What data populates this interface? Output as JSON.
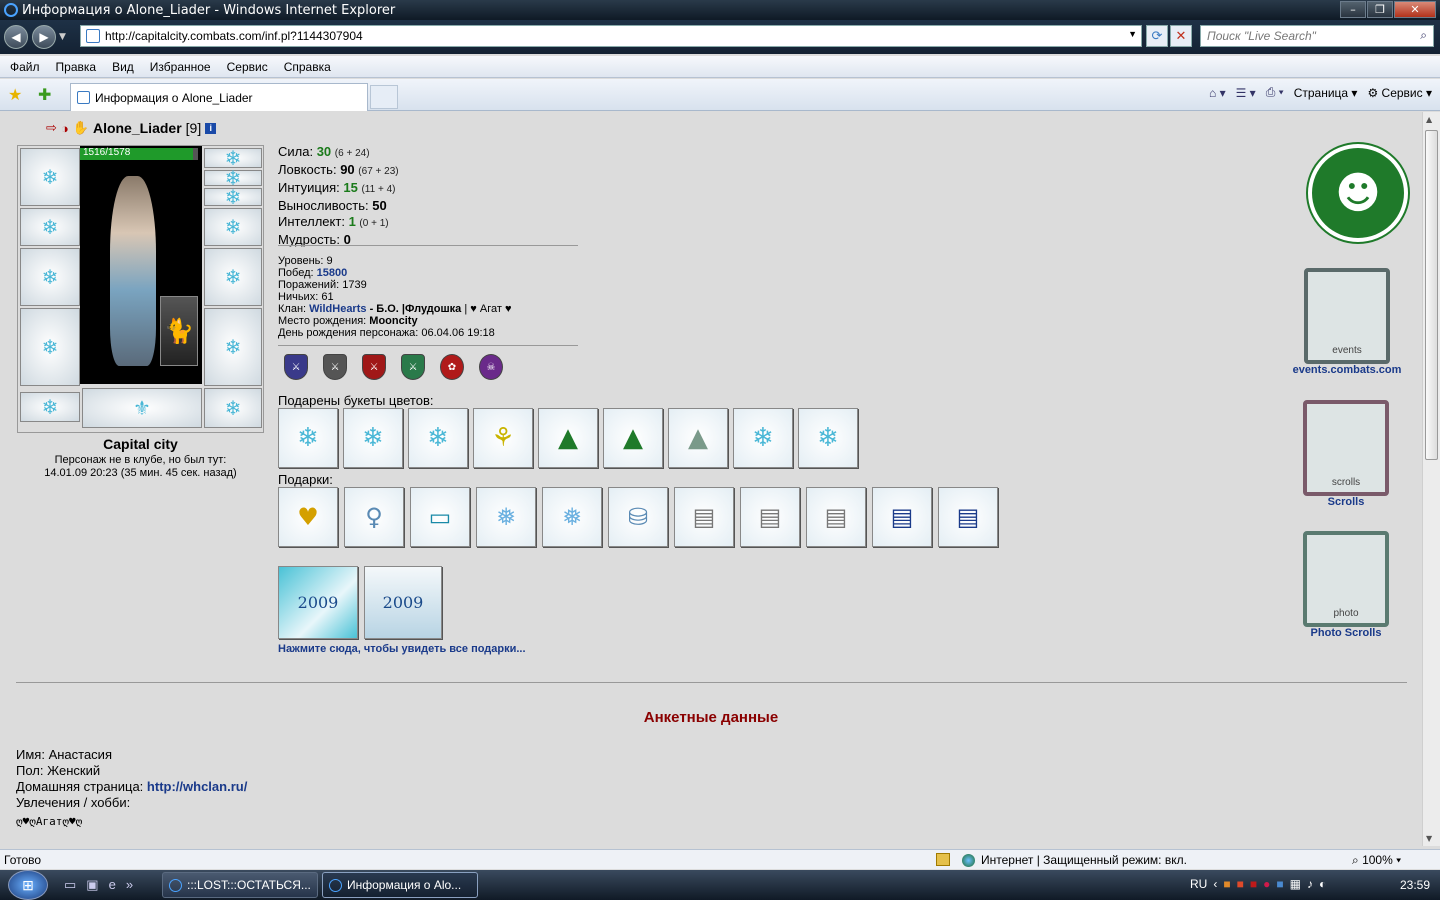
{
  "window": {
    "title": "Информация о Alone_Liader - Windows Internet Explorer",
    "address": "http://capitalcity.combats.com/inf.pl?1144307904",
    "search_placeholder": "Поиск \"Live Search\""
  },
  "menu": [
    "Файл",
    "Правка",
    "Вид",
    "Избранное",
    "Сервис",
    "Справка"
  ],
  "tab": {
    "label": "Информация о Alone_Liader"
  },
  "commandbar": {
    "page_label": "Страница",
    "tools_label": "Сервис"
  },
  "character": {
    "name": "Alone_Liader",
    "level": "[9]",
    "hp": "1516/1578",
    "hp_fraction": 0.96,
    "city": "Capital city",
    "status_line1": "Персонаж не в клубе, но был тут:",
    "status_line2": "14.01.09 20:23 (35 мин. 45 сек. назад)"
  },
  "stats": [
    {
      "label": "Сила:",
      "value": "30",
      "detail": "(6 + 24)",
      "green": true
    },
    {
      "label": "Ловкость:",
      "value": "90",
      "detail": "(67 + 23)",
      "green": false
    },
    {
      "label": "Интуиция:",
      "value": "15",
      "detail": "(11 + 4)",
      "green": true
    },
    {
      "label": "Выносливость:",
      "value": "50",
      "detail": "",
      "green": false
    },
    {
      "label": "Интеллект:",
      "value": "1",
      "detail": "(0 + 1)",
      "green": true
    },
    {
      "label": "Мудрость:",
      "value": "0",
      "detail": "",
      "green": false
    }
  ],
  "info": {
    "level_label": "Уровень:",
    "level_value": "9",
    "wins_label": "Побед:",
    "wins_value": "15800",
    "losses_label": "Поражений:",
    "losses_value": "1739",
    "draws_label": "Ничьих:",
    "draws_value": "61",
    "clan_label": "Клан:",
    "clan_name": "WildHearts",
    "clan_rest": "- Б.О. |Флудошка",
    "clan_extra": "| ♥ Агат ♥",
    "birthplace_label": "Место рождения:",
    "birthplace_value": "Mooncity",
    "birthday_label": "День рождения персонажа:",
    "birthday_value": "06.04.06 19:18"
  },
  "flowers_title": "Подарены букеты цветов:",
  "gifts_title": "Подарки:",
  "cards": [
    "2009",
    "2009"
  ],
  "all_gifts_link": "Нажмите сюда, чтобы увидеть все подарки...",
  "right_links": {
    "events": "events.combats.com",
    "events_banner": "events",
    "scrolls": "Scrolls",
    "scrolls_banner": "scrolls",
    "photo": "Photo Scrolls",
    "photo_banner": "photo"
  },
  "profile": {
    "heading": "Анкетные данные",
    "name_label": "Имя:",
    "name_value": "Анастасия",
    "gender_label": "Пол:",
    "gender_value": "Женский",
    "homepage_label": "Домашняя страница:",
    "homepage_value": "http://whclan.ru/",
    "hobby_label": "Увлечения / хобби:",
    "hobby_value": "ღ♥ღАгатღ♥ღ"
  },
  "statusbar": {
    "ready": "Готово",
    "zone": "Интернет | Защищенный режим: вкл.",
    "zoom": "100%"
  },
  "taskbar": {
    "btn1": ":::LOST:::ОСТАТЬСЯ...",
    "btn2": "Информация о Alo...",
    "lang": "RU",
    "clock": "23:59"
  }
}
